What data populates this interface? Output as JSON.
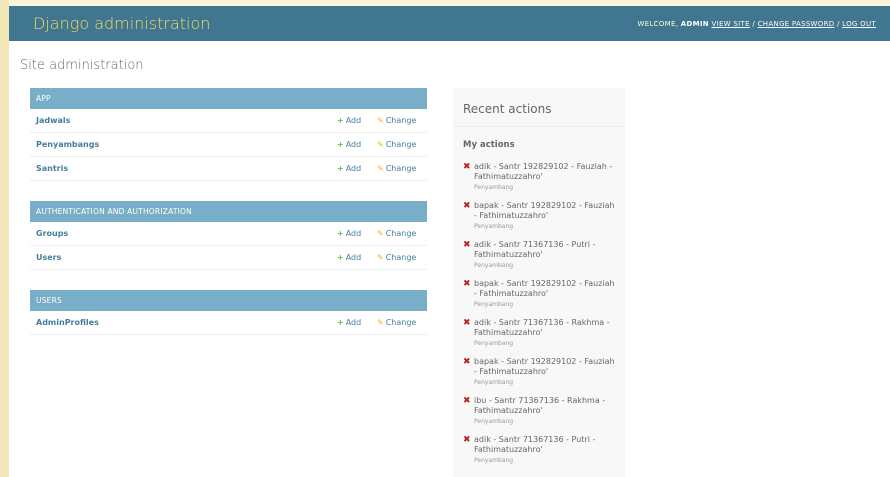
{
  "header": {
    "brand": "Django administration",
    "welcome": "WELCOME,",
    "username": "ADMIN",
    "view_site": "VIEW SITE",
    "change_password": "CHANGE PASSWORD",
    "log_out": "LOG OUT"
  },
  "title": "Site administration",
  "modules": [
    {
      "caption": "APP",
      "rows": [
        {
          "name": "Jadwals",
          "add": "Add",
          "change": "Change"
        },
        {
          "name": "Penyambangs",
          "add": "Add",
          "change": "Change"
        },
        {
          "name": "Santris",
          "add": "Add",
          "change": "Change"
        }
      ]
    },
    {
      "caption": "AUTHENTICATION AND AUTHORIZATION",
      "rows": [
        {
          "name": "Groups",
          "add": "Add",
          "change": "Change"
        },
        {
          "name": "Users",
          "add": "Add",
          "change": "Change"
        }
      ]
    },
    {
      "caption": "USERS",
      "rows": [
        {
          "name": "AdminProfiles",
          "add": "Add",
          "change": "Change"
        }
      ]
    }
  ],
  "recent": {
    "title": "Recent actions",
    "subtitle": "My actions",
    "actions": [
      {
        "text": "adik - Santr 192829102 - Fauziah - Fathimatuzzahro'",
        "type": "Penyambang"
      },
      {
        "text": "bapak - Santr 192829102 - Fauziah - Fathimatuzzahro'",
        "type": "Penyambang"
      },
      {
        "text": "adik - Santr 71367136 - Putri - Fathimatuzzahro'",
        "type": "Penyambang"
      },
      {
        "text": "bapak - Santr 192829102 - Fauziah - Fathimatuzzahro'",
        "type": "Penyambang"
      },
      {
        "text": "adik - Santr 71367136 - Rakhma - Fathimatuzzahro'",
        "type": "Penyambang"
      },
      {
        "text": "bapak - Santr 192829102 - Fauziah - Fathimatuzzahro'",
        "type": "Penyambang"
      },
      {
        "text": "ibu - Santr 71367136 - Rakhma - Fathimatuzzahro'",
        "type": "Penyambang"
      },
      {
        "text": "adik - Santr 71367136 - Putri - Fathimatuzzahro'",
        "type": "Penyambang"
      }
    ]
  },
  "colors": {
    "header_bg": "#417690",
    "brand": "#f5dd5d",
    "module_caption_bg": "#79aec8",
    "link": "#447e9b",
    "add_icon": "#70bf2b",
    "change_icon": "#efb80b",
    "delete_icon": "#ba2121"
  },
  "icons": {
    "add": "plus-icon",
    "change": "pencil-icon",
    "delete": "delete-x-icon"
  }
}
